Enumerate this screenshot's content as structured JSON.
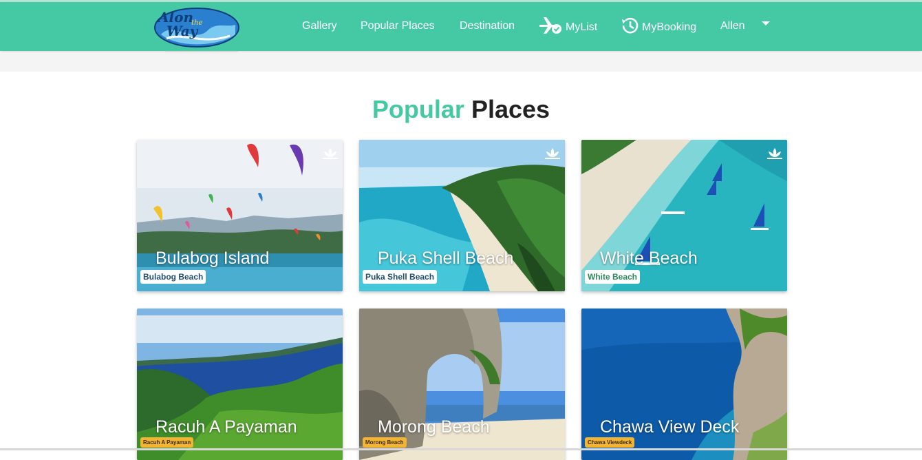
{
  "nav": {
    "logo_text": [
      "Alon",
      "the",
      "Way"
    ],
    "items": [
      "Gallery",
      "Popular Places",
      "Destination"
    ],
    "mylist": "MyList",
    "mybooking": "MyBooking",
    "user": "Allen"
  },
  "title": {
    "accent": "Popular",
    "rest": "Places"
  },
  "cards": [
    {
      "name": "Bulabog Island",
      "badge": "Bulabog Beach"
    },
    {
      "name": "Puka Shell Beach",
      "badge": "Puka Shell Beach"
    },
    {
      "name": "White Beach",
      "badge": "White Beach"
    },
    {
      "name": "Racuh A Payaman",
      "badge": "Racuh A Payaman"
    },
    {
      "name": "Morong Beach",
      "badge": "Morong Beach"
    },
    {
      "name": "Chawa View Deck",
      "badge": "Chawa Viewdeck"
    }
  ],
  "icons": {
    "mylist": "airplane-check-icon",
    "mybooking": "history-icon",
    "card": "lotus-icon",
    "user_menu": "caret-down-icon"
  },
  "colors": {
    "brand": "#45c9a5",
    "title_text": "#222222"
  }
}
